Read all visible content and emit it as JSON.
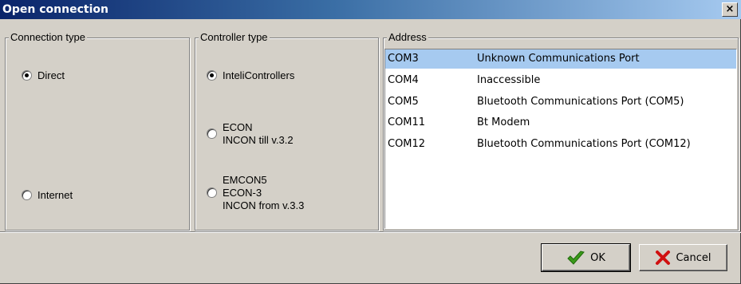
{
  "window": {
    "title": "Open connection",
    "close_label": "×"
  },
  "connection_type": {
    "legend": "Connection type",
    "options": [
      {
        "label": "Direct",
        "checked": true
      },
      {
        "label": "Internet",
        "checked": false
      }
    ]
  },
  "controller_type": {
    "legend": "Controller type",
    "options": [
      {
        "lines": [
          "InteliControllers"
        ],
        "checked": true
      },
      {
        "lines": [
          "ECON",
          "INCON till v.3.2"
        ],
        "checked": false
      },
      {
        "lines": [
          "EMCON5",
          "ECON-3",
          "INCON from v.3.3"
        ],
        "checked": false
      }
    ]
  },
  "address": {
    "legend": "Address",
    "rows": [
      {
        "port": "COM3",
        "description": "Unknown Communications Port",
        "selected": true
      },
      {
        "port": "COM4",
        "description": "Inaccessible",
        "selected": false
      },
      {
        "port": "COM5",
        "description": "Bluetooth Communications Port (COM5)",
        "selected": false
      },
      {
        "port": "COM11",
        "description": "Bt Modem",
        "selected": false
      },
      {
        "port": "COM12",
        "description": "Bluetooth Communications Port (COM12)",
        "selected": false
      }
    ]
  },
  "buttons": {
    "ok_label": "OK",
    "cancel_label": "Cancel"
  },
  "colors": {
    "selection": "#a6caf0",
    "ok_icon": "#3a9a1a",
    "cancel_icon": "#d01010"
  }
}
